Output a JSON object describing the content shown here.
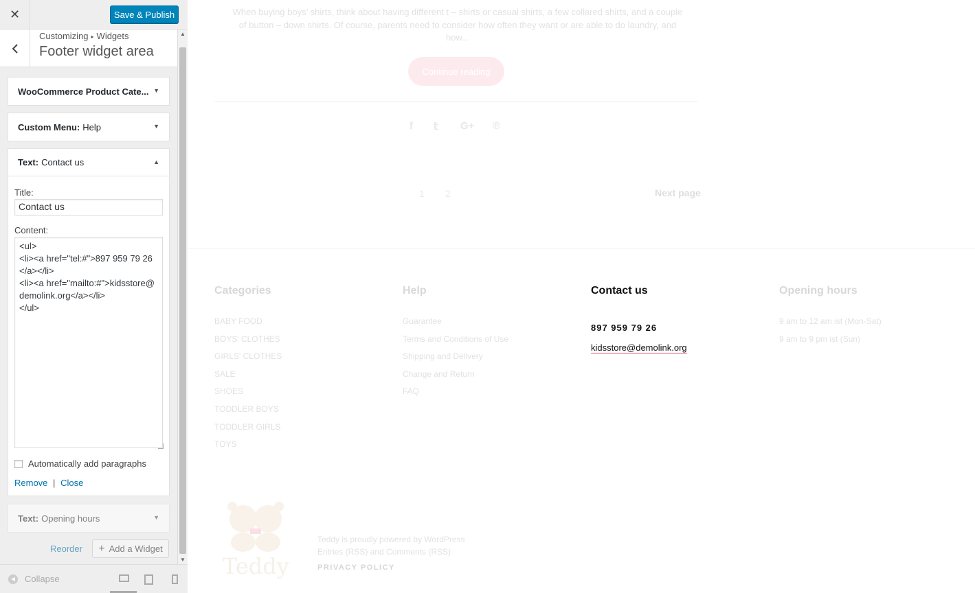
{
  "topbar": {
    "close_icon": "close-icon",
    "publish_label": "Save & Publish",
    "publish_color": "#0085ba"
  },
  "panel": {
    "breadcrumb": [
      "Customizing",
      "Widgets"
    ],
    "title": "Footer widget area"
  },
  "widgets": [
    {
      "type": "WooCommerce Product Cate...",
      "name": "",
      "expanded": false
    },
    {
      "type": "Custom Menu:",
      "name": "Help",
      "expanded": false
    },
    {
      "type": "Text:",
      "name": "Contact us",
      "expanded": true
    },
    {
      "type": "Text:",
      "name": "Opening hours",
      "expanded": false
    }
  ],
  "form": {
    "title_label": "Title:",
    "title_value": "Contact us",
    "content_label": "Content:",
    "content_value": "<ul>\n<li><a href=\"tel:#\">897 959 79 26</a></li>\n<li><a href=\"mailto:#\">kidsstore@demolink.org</a></li>\n</ul>",
    "auto_paragraphs_label": "Automatically add paragraphs",
    "auto_paragraphs_checked": false,
    "remove_label": "Remove",
    "separator": "|",
    "close_label": "Close"
  },
  "panel_actions": {
    "reorder_label": "Reorder",
    "add_widget_label": "Add a Widget"
  },
  "footer_controls": {
    "collapse_label": "Collapse",
    "devices": [
      "desktop",
      "tablet",
      "mobile"
    ],
    "active_device": "desktop"
  },
  "preview": {
    "excerpt": "When buying boys’ shirts, think about having different t – shirts or casual shirts, a few collared shirts, and a couple of button – down shirts. Of course, parents need to consider how often they want or are able to do laundry, and how...",
    "continue_label": "Continue reading",
    "accent_color": "#e2496b",
    "pages": [
      "1",
      "2"
    ],
    "next_page_label": "Next page",
    "columns": {
      "categories": {
        "title": "Categories",
        "items": [
          "Baby Food",
          "Boys' Clothes",
          "Girls' Clothes",
          "Sale",
          "Shoes",
          "Toddler Boys",
          "Toddler Girls",
          "Toys"
        ]
      },
      "help": {
        "title": "Help",
        "items": [
          "Guarantee",
          "Terms and Conditions of Use",
          "Shipping and Delivery",
          "Change and Return",
          "FAQ"
        ]
      },
      "contact": {
        "title": "Contact us",
        "phone": "897 959 79 26",
        "email": "kidsstore@demolink.org"
      },
      "hours": {
        "title": "Opening hours",
        "items": [
          "9 am to 12 am ist (Mon-Sat)",
          "9 am to 9 pm ist (Sun)"
        ]
      }
    },
    "logo_text": "Teddy",
    "copyright_lines": [
      "Teddy is proudly powered by WordPress",
      "Entries (RSS) and Comments (RSS)"
    ],
    "privacy_label": "PRIVACY POLICY"
  }
}
